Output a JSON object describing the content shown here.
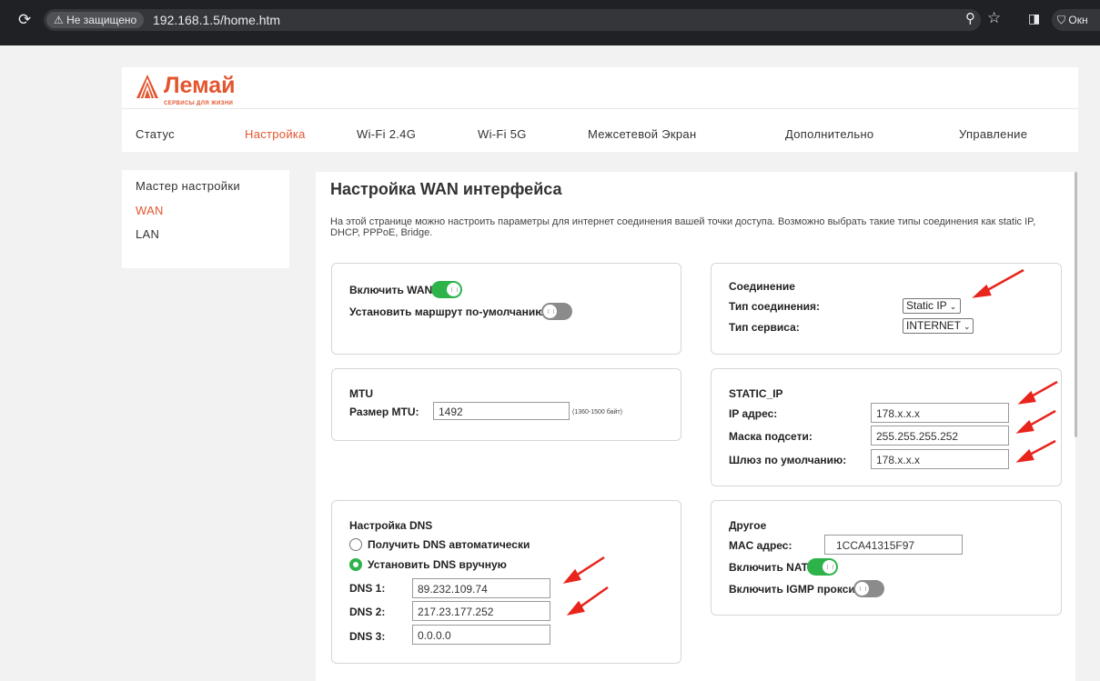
{
  "browser": {
    "reload_icon": "reload-icon",
    "security_label": "⚠ Не защищено",
    "url": "192.168.1.5/home.htm",
    "profile_label": "Окн"
  },
  "logo": {
    "name": "Лемай",
    "tagline": "СЕРВИСЫ ДЛЯ ЖИЗНИ"
  },
  "nav": {
    "status": "Статус",
    "setup": "Настройка",
    "wifi24": "Wi-Fi 2.4G",
    "wifi5": "Wi-Fi 5G",
    "firewall": "Межсетевой Экран",
    "advanced": "Дополнительно",
    "management": "Управление"
  },
  "sidebar": {
    "wizard": "Мастер настройки",
    "wan": "WAN",
    "lan": "LAN"
  },
  "page": {
    "title": "Настройка WAN интерфейса",
    "description": "На этой странице можно настроить параметры для интернет соединения вашей точки доступа. Возможно выбрать такие типы соединения как static IP, DHCP, PPPoE, Bridge."
  },
  "wan_box": {
    "enable_label": "Включить WAN",
    "enable_on": true,
    "default_route_label": "Установить маршрут по-умолчанию",
    "default_route_on": false
  },
  "connection": {
    "title": "Соединение",
    "type_label": "Тип соединения:",
    "type_value": "Static IP",
    "service_label": "Тип сервиса:",
    "service_value": "INTERNET"
  },
  "mtu": {
    "title": "MTU",
    "size_label": "Размер MTU:",
    "size_value": "1492",
    "range_hint": "(1360-1500 байт)"
  },
  "static_ip": {
    "title": "STATIC_IP",
    "ip_label": "IP адрес:",
    "ip_value": "178.x.x.x",
    "mask_label": "Маска подсети:",
    "mask_value": "255.255.255.252",
    "gateway_label": "Шлюз по умолчанию:",
    "gateway_value": "178.x.x.x"
  },
  "dns": {
    "title": "Настройка DNS",
    "auto_label": "Получить DNS автоматически",
    "manual_label": "Установить DNS вручную",
    "selected": "manual",
    "dns1_label": "DNS 1:",
    "dns1_value": "89.232.109.74",
    "dns2_label": "DNS 2:",
    "dns2_value": "217.23.177.252",
    "dns3_label": "DNS 3:",
    "dns3_value": "0.0.0.0"
  },
  "other": {
    "title": "Другое",
    "mac_label": "MAC адрес:",
    "mac_value": "1CCA41315F97",
    "nat_label": "Включить NAT",
    "nat_on": true,
    "igmp_label": "Включить IGMP прокси",
    "igmp_on": false
  },
  "colors": {
    "accent": "#e3552e",
    "toggle_on": "#2db34a",
    "toggle_off": "#8b8b8b",
    "annotation_arrow": "#e8241c"
  }
}
